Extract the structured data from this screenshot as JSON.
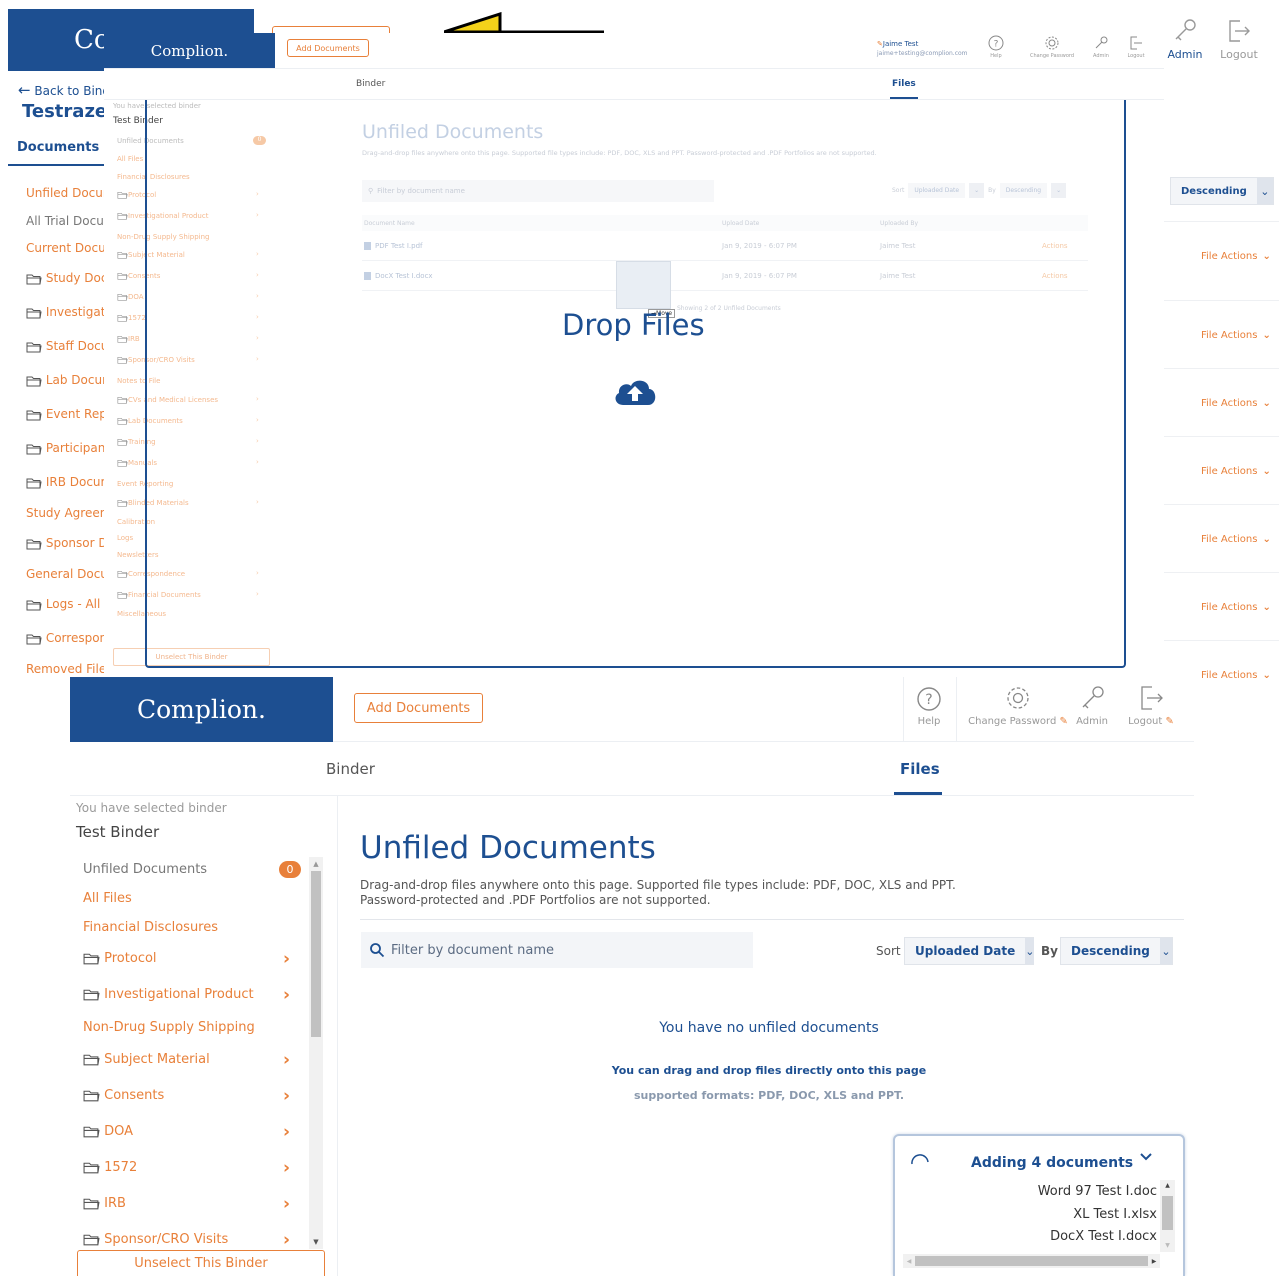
{
  "brand": {
    "name": "Complion.",
    "short": "Cc"
  },
  "header": {
    "add_documents": "Add Documents",
    "user_name": "Jaime Test",
    "user_email": "jaime+testing@complion.com",
    "help": "Help",
    "change_password": "Change Password",
    "admin": "Admin",
    "logout": "Logout"
  },
  "tabs": {
    "binder": "Binder",
    "files": "Files"
  },
  "back_panel": {
    "back_label": "Back to Bind",
    "study_name": "Testrazen",
    "documents_title": "Documents",
    "items": [
      {
        "label": "Unfiled Docum",
        "folder": false,
        "color": "orange"
      },
      {
        "label": "All Trial Docun",
        "folder": false,
        "color": "gray"
      },
      {
        "label": "Current Docun",
        "folder": false,
        "color": "orange"
      },
      {
        "label": "Study Docu",
        "folder": true
      },
      {
        "label": "Investigati",
        "folder": true
      },
      {
        "label": "Staff Docu",
        "folder": true
      },
      {
        "label": "Lab Docum",
        "folder": true
      },
      {
        "label": "Event Repo",
        "folder": true
      },
      {
        "label": "Participant",
        "folder": true
      },
      {
        "label": "IRB Docum",
        "folder": true
      },
      {
        "label": "Study Agreem",
        "folder": false,
        "color": "orange"
      },
      {
        "label": "Sponsor Dc",
        "folder": true
      },
      {
        "label": "General Docur",
        "folder": false,
        "color": "orange"
      },
      {
        "label": "Logs - All",
        "folder": true
      },
      {
        "label": "Correspon",
        "folder": true
      },
      {
        "label": "Removed Files",
        "folder": false,
        "color": "orange"
      }
    ],
    "sort_value": "Descending",
    "file_actions": "File Actions"
  },
  "faded": {
    "selected_hint": "You have selected binder",
    "binder_name": "Test Binder",
    "title": "Unfiled Documents",
    "desc": "Drag-and-drop files anywhere onto this page. Supported file types include: PDF, DOC, XLS and PPT. Password-protected and .PDF Portfolios are not supported.",
    "filter_placeholder": "Filter by document name",
    "sort_label": "Sort",
    "sort_value": "Uploaded Date",
    "by_label": "By",
    "order_value": "Descending",
    "col_name": "Document Name",
    "col_date": "Upload Date",
    "col_by": "Uploaded By",
    "rows": [
      {
        "name": "PDF Test I.pdf",
        "date": "Jan 9, 2019 - 6:07 PM",
        "by": "Jaime Test",
        "action": "Actions"
      },
      {
        "name": "DocX Test I.docx",
        "date": "Jan 9, 2019 - 6:07 PM",
        "by": "Jaime Test",
        "action": "Actions"
      }
    ],
    "showing": "Showing 2 of 2 Unfiled Documents",
    "move_label": "Move",
    "unselect": "Unselect This Binder",
    "sidebar": [
      {
        "label": "Unfiled Documents",
        "folder": false,
        "badge": "0"
      },
      {
        "label": "All Files",
        "folder": false
      },
      {
        "label": "Financial Disclosures",
        "folder": false
      },
      {
        "label": "Protocol",
        "folder": true,
        "chev": true
      },
      {
        "label": "Investigational Product",
        "folder": true,
        "chev": true
      },
      {
        "label": "Non-Drug Supply Shipping",
        "folder": false
      },
      {
        "label": "Subject Material",
        "folder": true,
        "chev": true
      },
      {
        "label": "Consents",
        "folder": true,
        "chev": true
      },
      {
        "label": "DOA",
        "folder": true,
        "chev": true
      },
      {
        "label": "1572",
        "folder": true,
        "chev": true
      },
      {
        "label": "IRB",
        "folder": true,
        "chev": true
      },
      {
        "label": "Sponsor/CRO Visits",
        "folder": true,
        "chev": true
      },
      {
        "label": "Notes to File",
        "folder": false
      },
      {
        "label": "CVs and Medical Licenses",
        "folder": true,
        "chev": true
      },
      {
        "label": "Lab Documents",
        "folder": true,
        "chev": true
      },
      {
        "label": "Training",
        "folder": true,
        "chev": true
      },
      {
        "label": "Manuals",
        "folder": true,
        "chev": true
      },
      {
        "label": "Event Reporting",
        "folder": false
      },
      {
        "label": "Blinded Materials",
        "folder": true,
        "chev": true
      },
      {
        "label": "Calibration",
        "folder": false
      },
      {
        "label": "Logs",
        "folder": false
      },
      {
        "label": "Newsletters",
        "folder": false
      },
      {
        "label": "Correspondence",
        "folder": true,
        "chev": true
      },
      {
        "label": "Financial Documents",
        "folder": true,
        "chev": true
      },
      {
        "label": "Miscellaneous",
        "folder": false
      }
    ]
  },
  "drop": {
    "label": "Drop Files"
  },
  "main": {
    "selected_hint": "You have selected binder",
    "binder_name": "Test Binder",
    "sidebar": [
      {
        "label": "Unfiled Documents",
        "folder": false,
        "badge": "0",
        "color": "gray"
      },
      {
        "label": "All Files",
        "folder": false
      },
      {
        "label": "Financial Disclosures",
        "folder": false
      },
      {
        "label": "Protocol",
        "folder": true,
        "chev": true
      },
      {
        "label": "Investigational Product",
        "folder": true,
        "chev": true
      },
      {
        "label": "Non-Drug Supply Shipping",
        "folder": false
      },
      {
        "label": "Subject Material",
        "folder": true,
        "chev": true
      },
      {
        "label": "Consents",
        "folder": true,
        "chev": true
      },
      {
        "label": "DOA",
        "folder": true,
        "chev": true
      },
      {
        "label": "1572",
        "folder": true,
        "chev": true
      },
      {
        "label": "IRB",
        "folder": true,
        "chev": true
      },
      {
        "label": "Sponsor/CRO Visits",
        "folder": true,
        "chev": true
      }
    ],
    "unselect": "Unselect This Binder",
    "title": "Unfiled Documents",
    "desc_1": "Drag-and-drop files anywhere onto this page. Supported file types include: PDF, DOC, XLS and PPT.",
    "desc_2": "Password-protected and .PDF Portfolios are not supported.",
    "filter_placeholder": "Filter by document name",
    "sort_label": "Sort",
    "sort_value": "Uploaded Date",
    "by_label": "By",
    "order_value": "Descending",
    "empty_title": "You have no unfiled documents",
    "empty_hint": "You can drag and drop files directly onto this page",
    "empty_formats": "supported formats: PDF, DOC, XLS and PPT."
  },
  "upload": {
    "title": "Adding 4 documents",
    "files": [
      "Word 97 Test I.doc",
      "XL Test I.xlsx",
      "DocX Test I.docx"
    ]
  },
  "colors": {
    "navy": "#1d4f91",
    "orange": "#e8803a"
  }
}
